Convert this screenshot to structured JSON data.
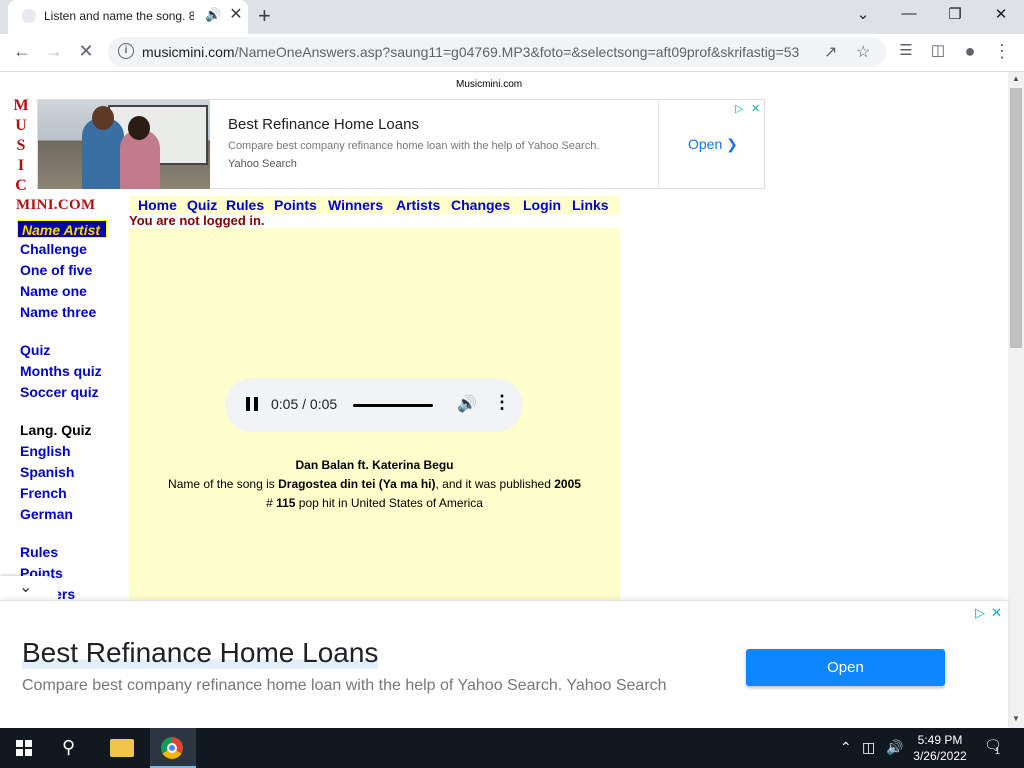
{
  "browser": {
    "tab_title": "Listen and name the song. 8",
    "tab_audio_icon": "speaker-icon",
    "url_host": "musicmini.com",
    "url_path": "/NameOneAnswers.asp?saung11=g04769.MP3&foto=&selectsong=aft09prof&skrifastig=53"
  },
  "page": {
    "site_top_label": "Musicmini.com",
    "logo_letters": [
      "M",
      "U",
      "S",
      "I",
      "C"
    ],
    "logo_text": "MINI.COM",
    "login_status": "You are not logged in."
  },
  "ad_top": {
    "title": "Best Refinance Home Loans",
    "description": "Compare best company refinance home loan with the help of Yahoo Search.",
    "source": "Yahoo Search",
    "cta": "Open"
  },
  "left_nav": {
    "group1": [
      "Name Artist",
      "Challenge",
      "One of five",
      "Name one",
      "Name three"
    ],
    "group2": [
      "Quiz",
      "Months quiz",
      "Soccer quiz"
    ],
    "group3_heading": "Lang. Quiz",
    "group3": [
      "English",
      "Spanish",
      "French",
      "German"
    ],
    "group4": [
      "Rules",
      "Points",
      "Winners"
    ]
  },
  "top_nav": [
    "Home",
    "Quiz",
    "Rules",
    "Points",
    "Winners",
    "Artists",
    "Changes",
    "Login",
    "Links"
  ],
  "player": {
    "time": "0:05 / 0:05",
    "progress": 1.0
  },
  "song": {
    "artist": "Dan Balan ft. Katerina Begu",
    "prefix": "Name of the song is ",
    "title": "Dragostea din tei (Ya ma hi)",
    "middle": ", and it was published ",
    "year": "2005",
    "rank_prefix": "# ",
    "rank": "115",
    "rank_suffix": " pop hit in United States of America"
  },
  "ad_bottom": {
    "title": "Best Refinance Home Loans",
    "description": "Compare best company refinance home loan with the help of Yahoo Search. Yahoo Search",
    "cta": "Open"
  },
  "taskbar": {
    "time": "5:49 PM",
    "date": "3/26/2022",
    "notification_count": "1"
  }
}
